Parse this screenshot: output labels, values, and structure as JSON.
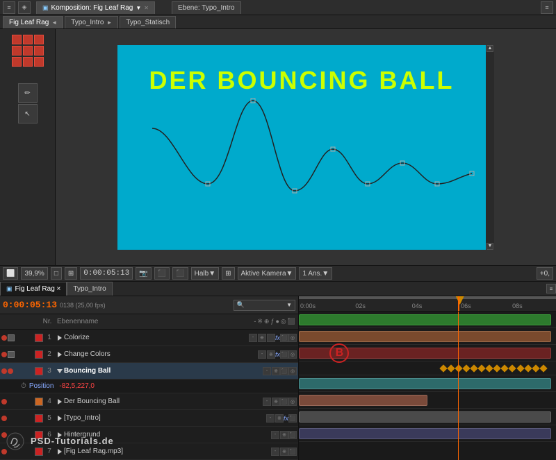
{
  "app": {
    "title": "After Effects"
  },
  "top_toolbar": {
    "tabs": [
      {
        "label": "Komposition: Fig Leaf Rag",
        "active": true,
        "close": true
      },
      {
        "label": "Ebene: Typo_Intro",
        "active": false,
        "close": false
      }
    ]
  },
  "composition_tabs": [
    {
      "label": "Fig Leaf Rag",
      "active": true
    },
    {
      "label": "Typo_Intro",
      "active": false
    },
    {
      "label": "Typo_Statisch",
      "active": false
    }
  ],
  "preview": {
    "title": "DER BOUNCING BALL",
    "zoom": "39,9%",
    "timecode": "0:00:05:13",
    "quality": "Halb",
    "camera": "Aktive Kamera",
    "views": "1 Ans.",
    "offset": "+0,"
  },
  "timeline": {
    "tabs": [
      {
        "label": "Fig Leaf Rag ×",
        "active": true
      },
      {
        "label": "Typo_Intro",
        "active": false
      }
    ],
    "timecode": "0:00:05:13",
    "fps": "0138 (25,00 fps)",
    "search_placeholder": "🔍",
    "time_markers": [
      "0:00s",
      "02s",
      "04s",
      "06s",
      "08s"
    ],
    "playhead_position": "62%"
  },
  "layer_headers": {
    "nr": "Nr.",
    "name": "Ebenenname",
    "icons": [
      "-※",
      "∫",
      "ƒ",
      "🔵",
      "📋"
    ]
  },
  "layers": [
    {
      "nr": 1,
      "name": "Colorize",
      "color": "#cc2222",
      "has_fx": true,
      "expanded": false,
      "solo": false,
      "lock": false,
      "vis": true,
      "track_type": "green",
      "track_start": 0,
      "track_width": 100
    },
    {
      "nr": 2,
      "name": "Change Colors",
      "color": "#cc2222",
      "has_fx": true,
      "expanded": false,
      "solo": false,
      "lock": false,
      "vis": true,
      "track_type": "brown",
      "track_start": 0,
      "track_width": 100
    },
    {
      "nr": 3,
      "name": "Bouncing Ball",
      "color": "#cc2222",
      "has_fx": false,
      "expanded": true,
      "solo": false,
      "lock": false,
      "vis": true,
      "track_type": "dark-red",
      "track_start": 0,
      "track_width": 100,
      "sub_property": {
        "label": "Position",
        "value": "-82,5,227,0"
      }
    },
    {
      "nr": 4,
      "name": "Der Bouncing Ball",
      "color": "#cc6622",
      "has_fx": false,
      "expanded": false,
      "solo": false,
      "lock": false,
      "vis": true,
      "track_type": "teal",
      "track_start": 0,
      "track_width": 100
    },
    {
      "nr": 5,
      "name": "[Typo_Intro]",
      "color": "#cc2222",
      "has_fx": true,
      "expanded": false,
      "solo": false,
      "lock": false,
      "vis": true,
      "track_type": "purple",
      "track_start": 0,
      "track_width": 100
    },
    {
      "nr": 6,
      "name": "Hintergrund",
      "color": "#cc2222",
      "has_fx": false,
      "expanded": false,
      "solo": false,
      "lock": false,
      "vis": true,
      "track_type": "gray",
      "track_start": 0,
      "track_width": 100
    },
    {
      "nr": 7,
      "name": "[Fig Leaf Rag.mp3]",
      "color": "#cc2222",
      "has_fx": false,
      "expanded": false,
      "solo": false,
      "lock": false,
      "vis": true,
      "track_type": "gray",
      "track_start": 0,
      "track_width": 100
    }
  ],
  "logo": {
    "text": "PSD-Tutorials.de"
  }
}
